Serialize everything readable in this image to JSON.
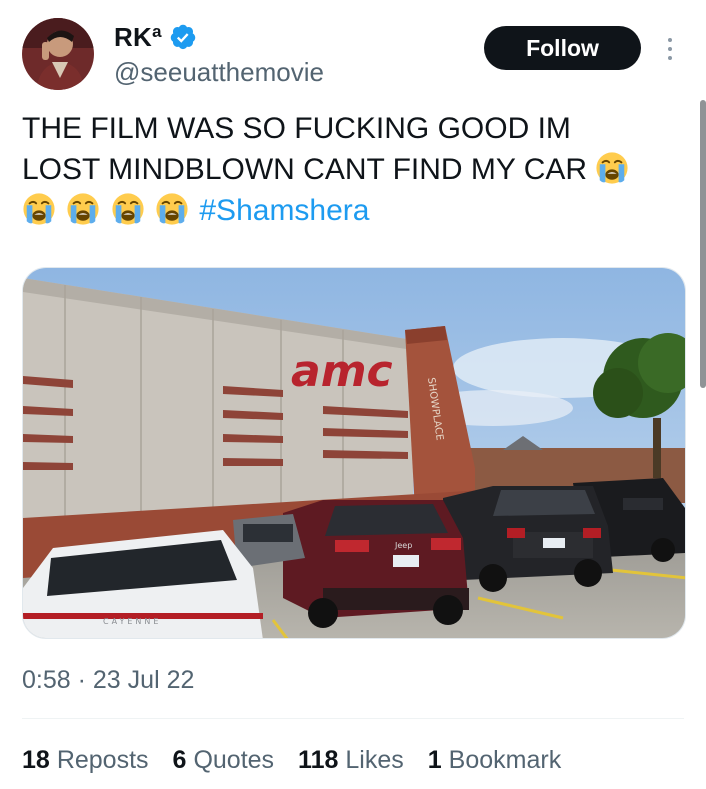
{
  "header": {
    "display_name": "RKª",
    "handle": "@seeuatthemovie",
    "follow_label": "Follow",
    "verified": true,
    "verified_color": "#1d9bf0"
  },
  "tweet": {
    "text_line1": "THE FILM WAS SO FUCKING GOOD IM",
    "text_line2": "LOST MINDBLOWN CANT FIND MY CAR",
    "emoji": "loudly-crying-face",
    "hashtag": "#Shamshera",
    "hashtag_color": "#1d9bf0"
  },
  "media": {
    "sign_text": "amc",
    "vertical_sign": "SHOWPLACE",
    "jeep_badge": "Jeep",
    "porsche_badge": "CAYENNE"
  },
  "meta": {
    "time": "0:58",
    "separator": "·",
    "date": "23 Jul 22"
  },
  "stats": [
    {
      "value": "18",
      "label": "Reposts"
    },
    {
      "value": "6",
      "label": "Quotes"
    },
    {
      "value": "118",
      "label": "Likes"
    },
    {
      "value": "1",
      "label": "Bookmark"
    }
  ],
  "colors": {
    "text_primary": "#0f1419",
    "text_secondary": "#536471",
    "follow_bg": "#0f1419",
    "link": "#1d9bf0"
  }
}
